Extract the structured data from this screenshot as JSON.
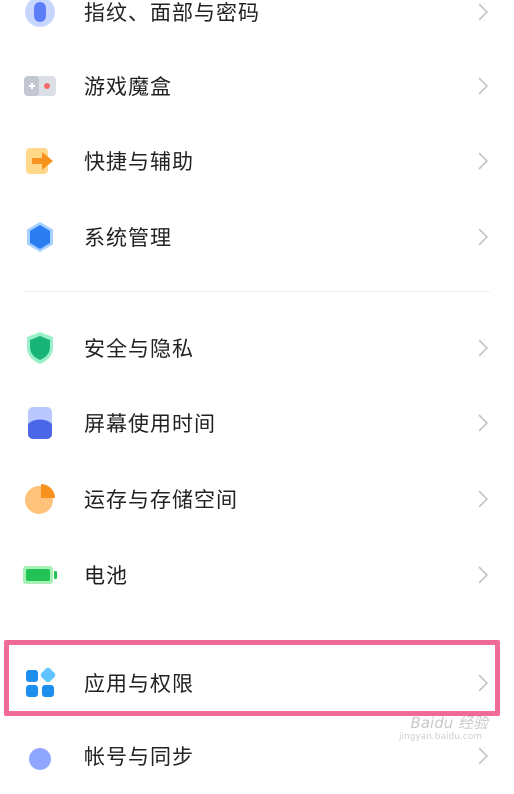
{
  "settings": {
    "items": [
      {
        "label": "指纹、面部与密码",
        "icon": "fingerprint-icon"
      },
      {
        "label": "游戏魔盒",
        "icon": "game-box-icon"
      },
      {
        "label": "快捷与辅助",
        "icon": "shortcut-icon"
      },
      {
        "label": "系统管理",
        "icon": "system-manage-icon"
      },
      {
        "label": "安全与隐私",
        "icon": "shield-icon"
      },
      {
        "label": "屏幕使用时间",
        "icon": "screen-time-icon"
      },
      {
        "label": "运存与存储空间",
        "icon": "storage-icon"
      },
      {
        "label": "电池",
        "icon": "battery-icon"
      },
      {
        "label": "应用与权限",
        "icon": "apps-permissions-icon"
      },
      {
        "label": "帐号与同步",
        "icon": "account-icon"
      }
    ]
  },
  "highlight": {
    "target": "应用与权限",
    "color": "#f06a98"
  },
  "watermark": {
    "text": "Baidu 经验",
    "sub": "jingyan.baidu.com"
  }
}
